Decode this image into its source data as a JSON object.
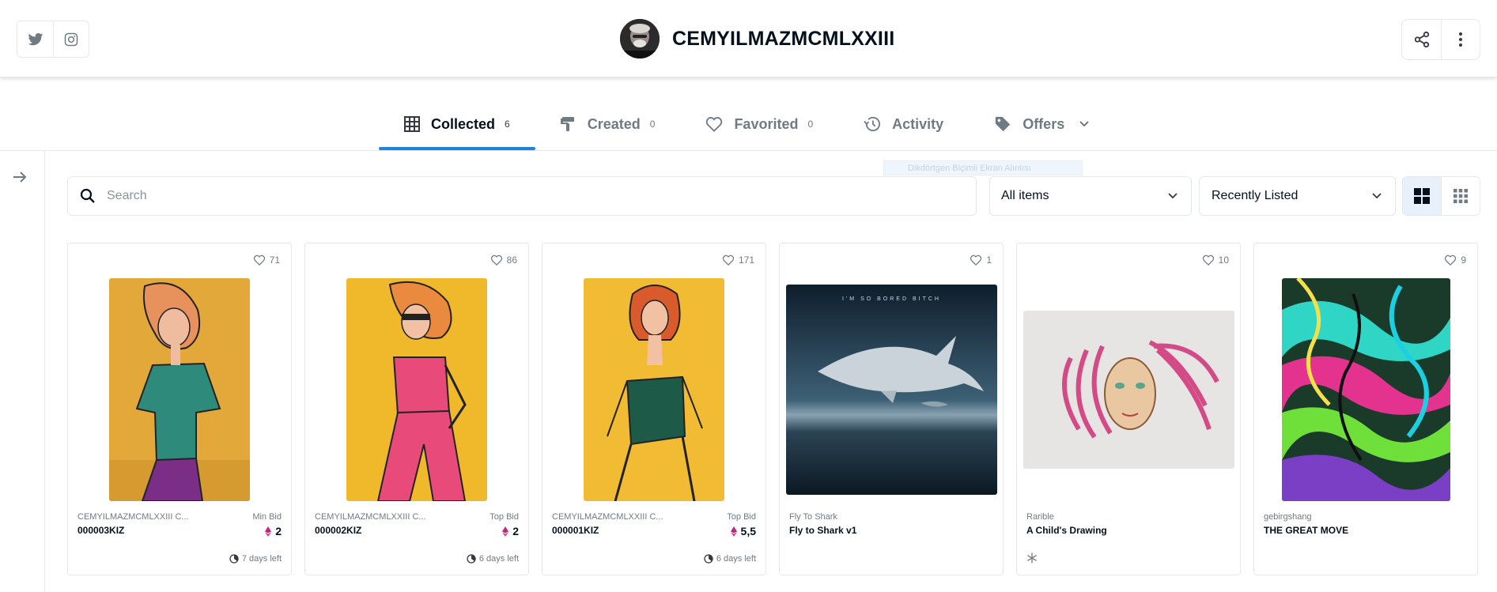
{
  "header": {
    "username": "CEMYILMAZMCMLXXIII",
    "social": [
      {
        "icon": "twitter-icon"
      },
      {
        "icon": "instagram-icon"
      }
    ],
    "actions": [
      {
        "icon": "share-icon"
      },
      {
        "icon": "more-vertical-icon"
      }
    ]
  },
  "tabs": [
    {
      "label": "Collected",
      "count": "6",
      "icon": "grid-icon",
      "active": true
    },
    {
      "label": "Created",
      "count": "0",
      "icon": "brush-icon"
    },
    {
      "label": "Favorited",
      "count": "0",
      "icon": "heart-icon"
    },
    {
      "label": "Activity",
      "count": "",
      "icon": "history-icon"
    },
    {
      "label": "Offers",
      "count": "",
      "icon": "tag-icon"
    }
  ],
  "ghost_tooltip": "Dikdörtgen Biçimli Ekran Alıntısı",
  "filters": {
    "search_placeholder": "Search",
    "items_filter": "All items",
    "sort": "Recently Listed"
  },
  "colors": {
    "accent": "#2081e2",
    "eth": "#c0267a"
  },
  "cards": [
    {
      "likes": "71",
      "collection": "CEMYILMAZMCMLXXIII C...",
      "name": "000003KIZ",
      "bid_label": "Min Bid",
      "price": "2",
      "time_left": "7 days left"
    },
    {
      "likes": "86",
      "collection": "CEMYILMAZMCMLXXIII C...",
      "name": "000002KIZ",
      "bid_label": "Top Bid",
      "price": "2",
      "time_left": "6 days left"
    },
    {
      "likes": "171",
      "collection": "CEMYILMAZMCMLXXIII C...",
      "name": "000001KIZ",
      "bid_label": "Top Bid",
      "price": "5,5",
      "time_left": "6 days left"
    },
    {
      "likes": "1",
      "collection": "Fly To Shark",
      "name": "Fly to Shark v1",
      "art_caption": "I'M SO BORED BITCH"
    },
    {
      "likes": "10",
      "collection": "Rarible",
      "name": "A Child's Drawing"
    },
    {
      "likes": "9",
      "collection": "gebirgshang",
      "name": "THE GREAT MOVE"
    }
  ]
}
